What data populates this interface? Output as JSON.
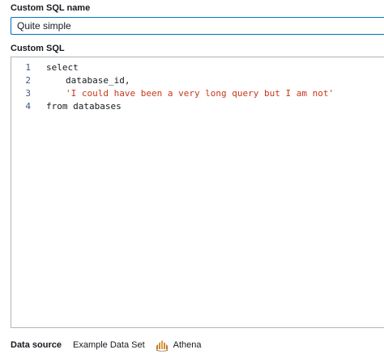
{
  "name_field": {
    "label": "Custom SQL name",
    "value": "Quite simple"
  },
  "sql_field": {
    "label": "Custom SQL",
    "lines": [
      {
        "number": "1",
        "text": "select"
      },
      {
        "number": "2",
        "text": "database_id,"
      },
      {
        "number": "3",
        "text": "'I could have been a very long query but I am not'"
      },
      {
        "number": "4",
        "text": "from databases"
      }
    ]
  },
  "footer": {
    "data_source_label": "Data source",
    "data_set_name": "Example Data Set",
    "source_type": "Athena",
    "source_icon": "athena-icon"
  },
  "colors": {
    "accent": "#0073bb",
    "string_literal": "#c7361b",
    "line_number": "#3b5a86",
    "athena_icon": "#b8782a"
  }
}
